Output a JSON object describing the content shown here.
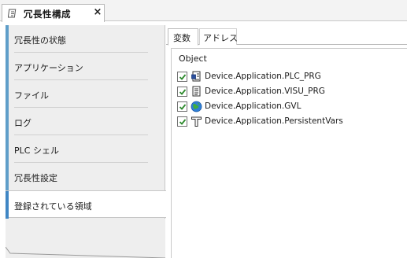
{
  "editor_tab": {
    "title": "冗長性構成",
    "icon": "document-pin-icon",
    "close": "×"
  },
  "sidebar": {
    "items": [
      {
        "label": "冗長性の状態"
      },
      {
        "label": "アプリケーション"
      },
      {
        "label": "ファイル"
      },
      {
        "label": "ログ"
      },
      {
        "label": "PLC シェル"
      },
      {
        "label": "冗長性設定"
      },
      {
        "label": "登録されている領域",
        "selected": true
      }
    ],
    "accent": "#3f86c4"
  },
  "subtabs": {
    "variables": "変数",
    "address": "アドレス"
  },
  "object_list": {
    "header": "Object",
    "check_color": "#2c8a2c",
    "rows": [
      {
        "label": "Device.Application.PLC_PRG",
        "icon": "pou-program-icon",
        "checked": true
      },
      {
        "label": "Device.Application.VISU_PRG",
        "icon": "document-lines-icon",
        "checked": true
      },
      {
        "label": "Device.Application.GVL",
        "icon": "globe-icon",
        "checked": true
      },
      {
        "label": "Device.Application.PersistentVars",
        "icon": "persistent-t-icon",
        "checked": true
      }
    ]
  }
}
